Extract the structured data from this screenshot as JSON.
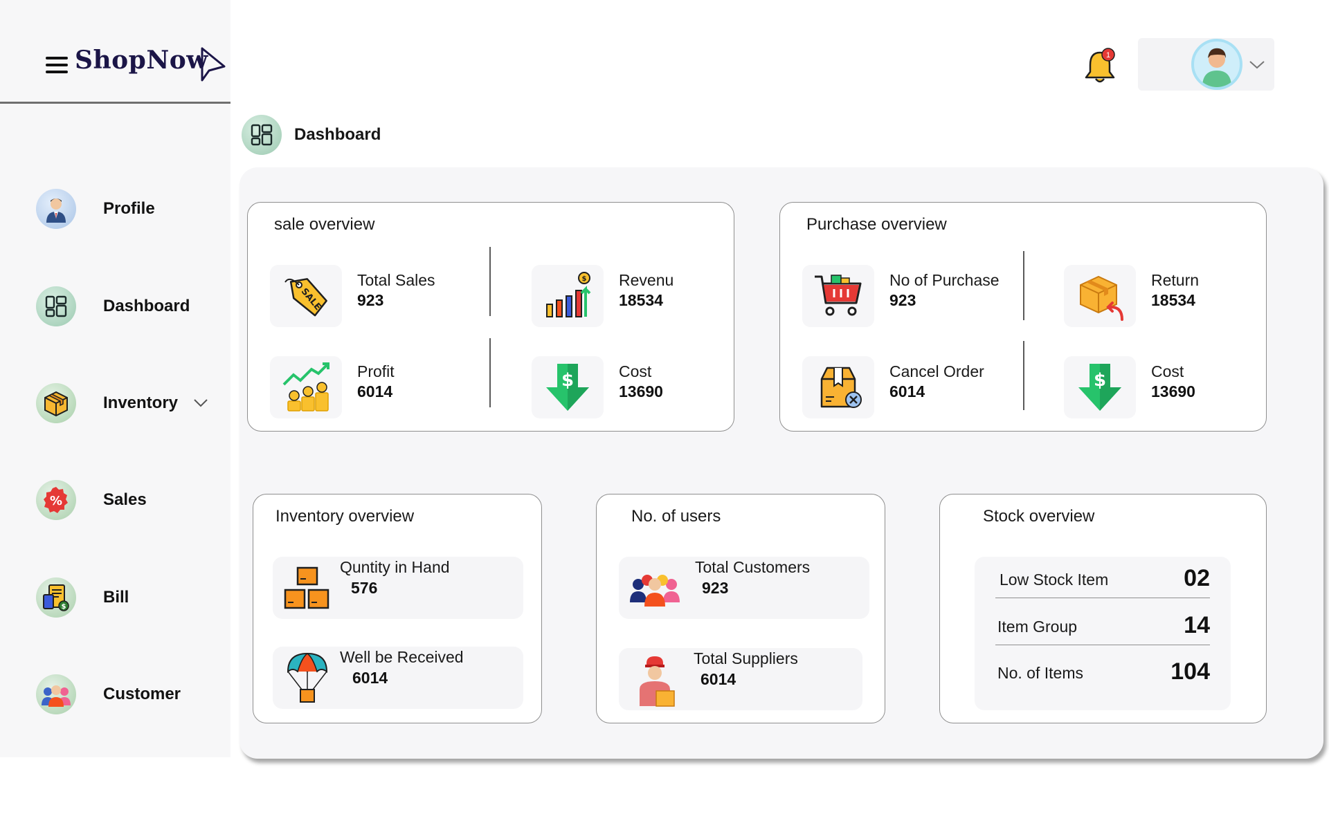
{
  "brand": {
    "name": "ShopNow"
  },
  "sidebar": {
    "items": [
      {
        "label": "Profile",
        "icon": "profile-avatar-icon"
      },
      {
        "label": "Dashboard",
        "icon": "dashboard-grid-icon"
      },
      {
        "label": "Inventory",
        "icon": "box-icon",
        "has_dropdown": true
      },
      {
        "label": "Sales",
        "icon": "percent-badge-icon"
      },
      {
        "label": "Bill",
        "icon": "bill-icon"
      },
      {
        "label": "Customer",
        "icon": "customers-icon"
      }
    ]
  },
  "header": {
    "notification_count": "1",
    "page_title": "Dashboard"
  },
  "sale_overview": {
    "title": "sale overview",
    "metrics": [
      {
        "label": "Total Sales",
        "value": "923",
        "icon": "sale-tag-icon"
      },
      {
        "label": "Revenu",
        "value": "18534",
        "icon": "revenue-chart-icon"
      },
      {
        "label": "Profit",
        "value": "6014",
        "icon": "profit-coins-icon"
      },
      {
        "label": "Cost",
        "value": "13690",
        "icon": "cost-down-arrow-icon"
      }
    ]
  },
  "purchase_overview": {
    "title": "Purchase overview",
    "metrics": [
      {
        "label": "No of Purchase",
        "value": "923",
        "icon": "shopping-cart-icon"
      },
      {
        "label": "Return",
        "value": "18534",
        "icon": "return-box-icon"
      },
      {
        "label": "Cancel Order",
        "value": "6014",
        "icon": "cancel-order-icon"
      },
      {
        "label": "Cost",
        "value": "13690",
        "icon": "cost-down-arrow-icon"
      }
    ]
  },
  "inventory_overview": {
    "title": "Inventory overview",
    "rows": [
      {
        "label": "Quntity in Hand",
        "value": "576",
        "icon": "stacked-boxes-icon"
      },
      {
        "label": "Well be Received",
        "value": "6014",
        "icon": "parachute-box-icon"
      }
    ]
  },
  "users": {
    "title": "No. of users",
    "rows": [
      {
        "label": "Total Customers",
        "value": "923",
        "icon": "customers-group-icon"
      },
      {
        "label": "Total Suppliers",
        "value": "6014",
        "icon": "supplier-icon"
      }
    ]
  },
  "stock_overview": {
    "title": "Stock overview",
    "rows": [
      {
        "label": "Low Stock Item",
        "value": "02"
      },
      {
        "label": "Item Group",
        "value": "14"
      },
      {
        "label": "No. of Items",
        "value": "104"
      }
    ]
  },
  "colors": {
    "brand": "#1b1547",
    "panel_bg": "#f6f6f8",
    "card_border": "#8e8e8e",
    "notification_badge": "#e53935",
    "cost_arrow": "#27c36b"
  }
}
